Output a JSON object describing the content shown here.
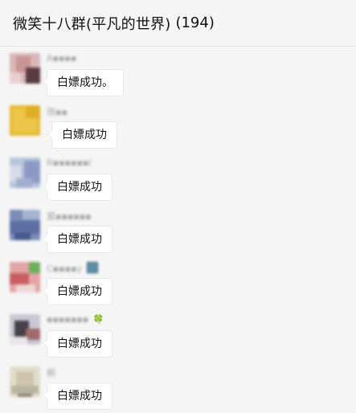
{
  "header": {
    "title": "微笑十八群(平凡的世界)",
    "count": "(194)"
  },
  "messages": [
    {
      "sender": "A▪▪▪▪",
      "text": "白嫖成功。"
    },
    {
      "sender": "琪▪▪",
      "text": "白嫖成功"
    },
    {
      "sender": "R▪▪▪▪▪▪I",
      "text": "白嫖成功"
    },
    {
      "sender": "莫▪▪▪▪▪▪",
      "text": "白嫖成功"
    },
    {
      "sender": "C▪▪▪▪y",
      "text": "白嫖成功"
    },
    {
      "sender": "▪▪▪▪▪▪▪",
      "emoji": "🍀",
      "text": "白嫖成功"
    },
    {
      "sender": "桐",
      "text": "白嫖成功"
    }
  ]
}
